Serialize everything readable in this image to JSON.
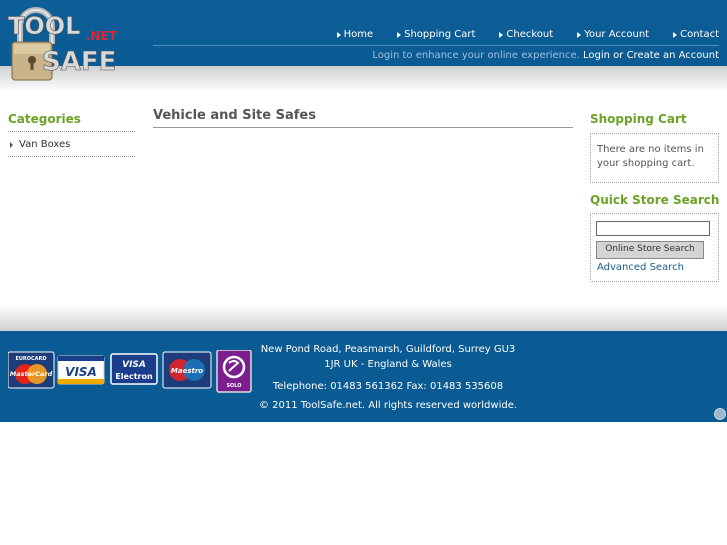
{
  "logo": {
    "line1": "TOOL",
    "line2": "SAFE",
    "net": ".NET"
  },
  "nav": {
    "items": [
      {
        "label": "Home"
      },
      {
        "label": "Shopping Cart"
      },
      {
        "label": "Checkout"
      },
      {
        "label": "Your Account"
      },
      {
        "label": "Contact"
      }
    ],
    "login_prompt": "Login to enhance your online experience.",
    "login_link": "Login or Create an Account"
  },
  "categories": {
    "heading": "Categories",
    "items": [
      {
        "label": "Van Boxes"
      }
    ]
  },
  "main": {
    "title": "Vehicle and Site Safes"
  },
  "cart": {
    "heading": "Shopping Cart",
    "empty_text": "There are no items in your shopping cart."
  },
  "search": {
    "heading": "Quick Store Search",
    "input_value": "",
    "button_label": "Online Store Search",
    "advanced_link": "Advanced Search"
  },
  "footer": {
    "address": "New Pond Road, Peasmarsh, Guildford, Surrey GU3 1JR UK - England & Wales",
    "phone": "Telephone: 01483 561362    Fax: 01483 535608",
    "copyright": "© 2011 ToolSafe.net. All rights reserved worldwide."
  },
  "payment_cards": {
    "mastercard_top": "EUROCARD",
    "mastercard": "MasterCard",
    "visa": "VISA",
    "visa_electron_top": "VISA",
    "visa_electron": "Electron",
    "maestro": "Maestro",
    "solo": "SOLO"
  },
  "colors": {
    "header_blue": "#0a5a93",
    "heading_green": "#6aa327",
    "link_blue": "#1b5c8f"
  }
}
